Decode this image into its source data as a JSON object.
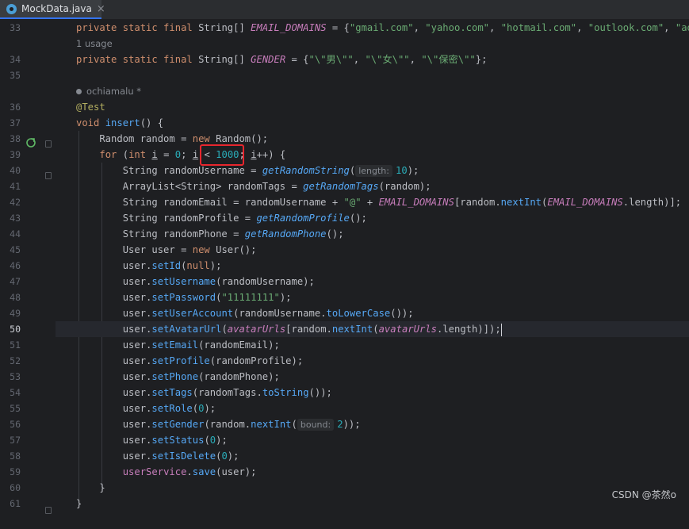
{
  "tab": {
    "label": "MockData.java",
    "close": "×",
    "icon": "java-class-icon"
  },
  "lines": [
    {
      "n": "33",
      "code": [
        {
          "t": "private static final ",
          "c": "kw"
        },
        {
          "t": "String[] "
        },
        {
          "t": "EMAIL_DOMAINS",
          "c": "field"
        },
        {
          "t": " = {"
        },
        {
          "t": "\"gmail.com\"",
          "c": "str"
        },
        {
          "t": ", "
        },
        {
          "t": "\"yahoo.com\"",
          "c": "str"
        },
        {
          "t": ", "
        },
        {
          "t": "\"hotmail.com\"",
          "c": "str"
        },
        {
          "t": ", "
        },
        {
          "t": "\"outlook.com\"",
          "c": "str"
        },
        {
          "t": ", "
        },
        {
          "t": "\"ao",
          "c": "str"
        }
      ]
    },
    {
      "hint": "1 usage"
    },
    {
      "n": "34",
      "code": [
        {
          "t": "private static final ",
          "c": "kw"
        },
        {
          "t": "String[] "
        },
        {
          "t": "GENDER",
          "c": "field"
        },
        {
          "t": " = {"
        },
        {
          "t": "\"\\\"男\\\"\"",
          "c": "str"
        },
        {
          "t": ", "
        },
        {
          "t": "\"\\\"女\\\"\"",
          "c": "str"
        },
        {
          "t": ", "
        },
        {
          "t": "\"\\\"保密\\\"\"",
          "c": "str"
        },
        {
          "t": "};"
        }
      ]
    },
    {
      "n": "35",
      "code": []
    },
    {
      "hint": "ochiamalu *",
      "author": true
    },
    {
      "n": "36",
      "code": [
        {
          "t": "@Test",
          "c": "ann"
        }
      ]
    },
    {
      "n": "37",
      "code": [
        {
          "t": "void ",
          "c": "kw"
        },
        {
          "t": "insert",
          "c": "method"
        },
        {
          "t": "() {"
        }
      ]
    },
    {
      "n": "38",
      "code": [
        {
          "t": "    Random random = "
        },
        {
          "t": "new ",
          "c": "kw"
        },
        {
          "t": "Random();"
        }
      ]
    },
    {
      "n": "39",
      "code": [
        {
          "t": "    "
        },
        {
          "t": "for ",
          "c": "kw"
        },
        {
          "t": "("
        },
        {
          "t": "int ",
          "c": "kw"
        },
        {
          "t": "i",
          "c": "ul"
        },
        {
          "t": " = "
        },
        {
          "t": "0",
          "c": "num"
        },
        {
          "t": "; "
        },
        {
          "t": "i",
          "c": "ul"
        },
        {
          "t": " < "
        },
        {
          "t": "1000",
          "c": "num"
        },
        {
          "t": "; "
        },
        {
          "t": "i",
          "c": "ul"
        },
        {
          "t": "++) {"
        }
      ]
    },
    {
      "n": "40",
      "code": [
        {
          "t": "        String randomUsername = "
        },
        {
          "t": "getRandomString",
          "c": "smethod"
        },
        {
          "t": "("
        },
        {
          "inlay": "length:"
        },
        {
          "t": "10",
          "c": "num"
        },
        {
          "t": ");"
        }
      ]
    },
    {
      "n": "41",
      "code": [
        {
          "t": "        ArrayList<String> randomTags = "
        },
        {
          "t": "getRandomTags",
          "c": "smethod"
        },
        {
          "t": "(random);"
        }
      ]
    },
    {
      "n": "42",
      "code": [
        {
          "t": "        String randomEmail = randomUsername + "
        },
        {
          "t": "\"@\"",
          "c": "str"
        },
        {
          "t": " + "
        },
        {
          "t": "EMAIL_DOMAINS",
          "c": "field"
        },
        {
          "t": "[random."
        },
        {
          "t": "nextInt",
          "c": "method"
        },
        {
          "t": "("
        },
        {
          "t": "EMAIL_DOMAINS",
          "c": "field"
        },
        {
          "t": ".length)];"
        }
      ]
    },
    {
      "n": "43",
      "code": [
        {
          "t": "        String randomProfile = "
        },
        {
          "t": "getRandomProfile",
          "c": "smethod"
        },
        {
          "t": "();"
        }
      ]
    },
    {
      "n": "44",
      "code": [
        {
          "t": "        String randomPhone = "
        },
        {
          "t": "getRandomPhone",
          "c": "smethod"
        },
        {
          "t": "();"
        }
      ]
    },
    {
      "n": "45",
      "code": [
        {
          "t": "        User user = "
        },
        {
          "t": "new ",
          "c": "kw"
        },
        {
          "t": "User();"
        }
      ]
    },
    {
      "n": "46",
      "code": [
        {
          "t": "        user."
        },
        {
          "t": "setId",
          "c": "method"
        },
        {
          "t": "("
        },
        {
          "t": "null",
          "c": "kw"
        },
        {
          "t": ");"
        }
      ]
    },
    {
      "n": "47",
      "code": [
        {
          "t": "        user."
        },
        {
          "t": "setUsername",
          "c": "method"
        },
        {
          "t": "(randomUsername);"
        }
      ]
    },
    {
      "n": "48",
      "code": [
        {
          "t": "        user."
        },
        {
          "t": "setPassword",
          "c": "method"
        },
        {
          "t": "("
        },
        {
          "t": "\"11111111\"",
          "c": "str"
        },
        {
          "t": ");"
        }
      ]
    },
    {
      "n": "49",
      "code": [
        {
          "t": "        user."
        },
        {
          "t": "setUserAccount",
          "c": "method"
        },
        {
          "t": "(randomUsername."
        },
        {
          "t": "toLowerCase",
          "c": "method"
        },
        {
          "t": "());"
        }
      ]
    },
    {
      "n": "50",
      "current": true,
      "code": [
        {
          "t": "        user."
        },
        {
          "t": "setAvatarUrl",
          "c": "method"
        },
        {
          "t": "("
        },
        {
          "t": "avatarUrls",
          "c": "field"
        },
        {
          "t": "[random."
        },
        {
          "t": "nextInt",
          "c": "method"
        },
        {
          "t": "("
        },
        {
          "t": "avatarUrls",
          "c": "field"
        },
        {
          "t": ".length)]);"
        },
        {
          "caret": true
        }
      ]
    },
    {
      "n": "51",
      "code": [
        {
          "t": "        user."
        },
        {
          "t": "setEmail",
          "c": "method"
        },
        {
          "t": "(randomEmail);"
        }
      ]
    },
    {
      "n": "52",
      "code": [
        {
          "t": "        user."
        },
        {
          "t": "setProfile",
          "c": "method"
        },
        {
          "t": "(randomProfile);"
        }
      ]
    },
    {
      "n": "53",
      "code": [
        {
          "t": "        user."
        },
        {
          "t": "setPhone",
          "c": "method"
        },
        {
          "t": "(randomPhone);"
        }
      ]
    },
    {
      "n": "54",
      "code": [
        {
          "t": "        user."
        },
        {
          "t": "setTags",
          "c": "method"
        },
        {
          "t": "(randomTags."
        },
        {
          "t": "toString",
          "c": "method"
        },
        {
          "t": "());"
        }
      ]
    },
    {
      "n": "55",
      "code": [
        {
          "t": "        user."
        },
        {
          "t": "setRole",
          "c": "method"
        },
        {
          "t": "("
        },
        {
          "t": "0",
          "c": "num"
        },
        {
          "t": ");"
        }
      ]
    },
    {
      "n": "56",
      "code": [
        {
          "t": "        user."
        },
        {
          "t": "setGender",
          "c": "method"
        },
        {
          "t": "(random."
        },
        {
          "t": "nextInt",
          "c": "method"
        },
        {
          "t": "("
        },
        {
          "inlay": "bound:"
        },
        {
          "t": "2",
          "c": "num"
        },
        {
          "t": "));"
        }
      ]
    },
    {
      "n": "57",
      "code": [
        {
          "t": "        user."
        },
        {
          "t": "setStatus",
          "c": "method"
        },
        {
          "t": "("
        },
        {
          "t": "0",
          "c": "num"
        },
        {
          "t": ");"
        }
      ]
    },
    {
      "n": "58",
      "code": [
        {
          "t": "        user."
        },
        {
          "t": "setIsDelete",
          "c": "method"
        },
        {
          "t": "("
        },
        {
          "t": "0",
          "c": "num"
        },
        {
          "t": ");"
        }
      ]
    },
    {
      "n": "59",
      "code": [
        {
          "t": "        "
        },
        {
          "t": "userService",
          "c": "field2"
        },
        {
          "t": "."
        },
        {
          "t": "save",
          "c": "method"
        },
        {
          "t": "(user);"
        }
      ]
    },
    {
      "n": "60",
      "code": [
        {
          "t": "    }"
        }
      ]
    },
    {
      "n": "61",
      "code": [
        {
          "t": "}"
        }
      ]
    }
  ],
  "watermark": "CSDN @茶然o",
  "colors": {
    "background": "#1e1f22",
    "highlight_box": "#e8262e",
    "tab_underline": "#3574f0"
  }
}
